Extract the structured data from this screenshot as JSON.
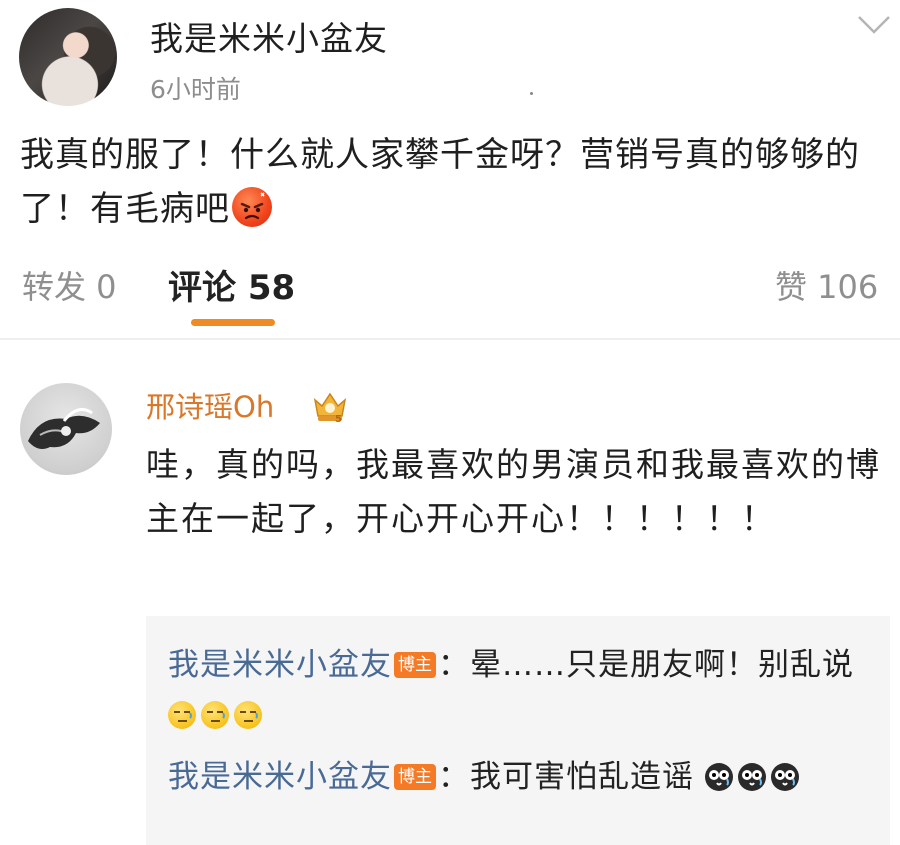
{
  "post": {
    "author": "我是米米小盆友",
    "time": "6小时前",
    "text": "我真的服了！什么就人家攀千金呀？营销号真的够够的了！有毛病吧",
    "tabs": {
      "repost": "转发 0",
      "comments": "评论 58",
      "likes": "赞 106"
    }
  },
  "comment": {
    "author": "邢诗瑶Oh",
    "text": "哇，真的吗，我最喜欢的男演员和我最喜欢的博主在一起了，开心开心开心！！！！！！",
    "replies": [
      {
        "author": "我是米米小盆友",
        "badge": "博主",
        "text": "：晕……只是朋友啊！别乱说",
        "emoji": "smirk-emoji"
      },
      {
        "author": "我是米米小盆友",
        "badge": "博主",
        "text": "：我可害怕乱造谣",
        "emoji": "scared-emoji"
      }
    ]
  },
  "colors": {
    "author_link": "#4a6a96",
    "commenter_name": "#d9782a",
    "accent_underline": "#f08a24",
    "badge_bg": "#f47a25",
    "reply_bg": "#f5f5f5"
  }
}
